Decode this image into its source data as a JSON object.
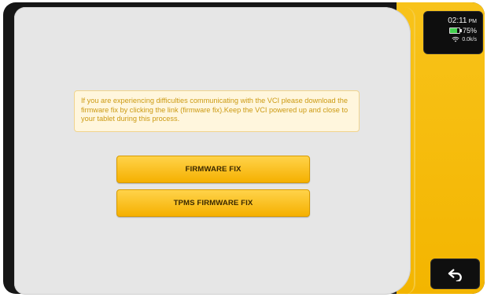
{
  "message": {
    "text": "If you are experiencing difficulties communicating with the VCI please download the firmware fix by clicking the link (firmware fix).Keep the VCI powered up and close to your tablet during this process."
  },
  "buttons": {
    "firmware_fix": "FIRMWARE FIX",
    "tpms_firmware_fix": "TPMS FIRMWARE FIX"
  },
  "status": {
    "time": "02:11",
    "ampm": "PM",
    "battery_text": "75%",
    "battery_level": 0.75,
    "network_text": "0.0k/s"
  },
  "icons": {
    "battery": "battery-icon",
    "wifi": "wifi-icon",
    "back": "back-arrow-icon"
  },
  "colors": {
    "accent_yellow": "#f3b500",
    "button_gradient_top": "#ffd34a",
    "message_text": "#cc9a12",
    "message_bg": "#fff6dd"
  }
}
